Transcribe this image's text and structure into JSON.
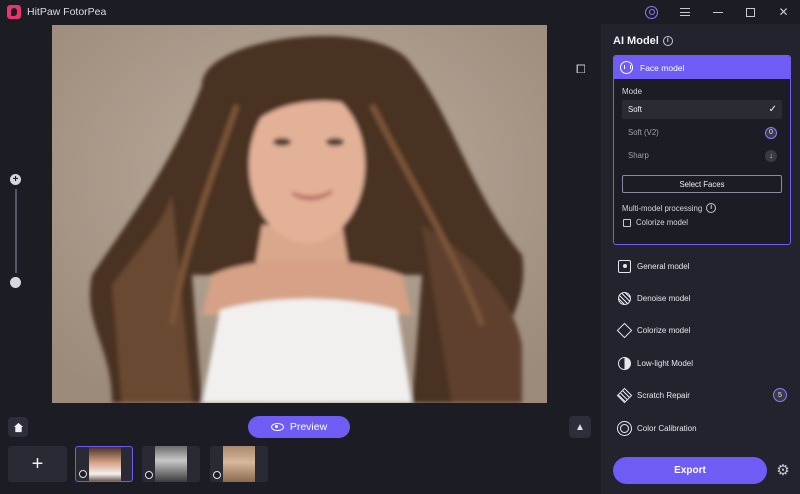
{
  "app": {
    "title": "HitPaw FotorPea"
  },
  "window_controls": {
    "user": "user-icon",
    "menu": "menu-icon",
    "minimize": "minimize-icon",
    "maximize": "maximize-icon",
    "close": "close-icon"
  },
  "canvas": {
    "zoom_in": "+",
    "zoom_out": "−"
  },
  "bottom": {
    "preview_label": "Preview",
    "add_label": "+",
    "thumbnails": [
      "portrait-color",
      "portrait-bw",
      "portrait-sepia"
    ]
  },
  "panel": {
    "title": "AI Model",
    "face_model": {
      "label": "Face model",
      "mode_label": "Mode",
      "modes": [
        {
          "label": "Soft",
          "state": "selected"
        },
        {
          "label": "Soft (V2)",
          "state": "badge",
          "badge": "0"
        },
        {
          "label": "Sharp",
          "state": "download"
        }
      ],
      "select_faces": "Select Faces",
      "multi_model": "Multi-model processing",
      "colorize_option": "Colorize model"
    },
    "models": [
      {
        "label": "General model",
        "icon": "image-icon"
      },
      {
        "label": "Denoise model",
        "icon": "denoise-icon"
      },
      {
        "label": "Colorize model",
        "icon": "colorize-icon"
      },
      {
        "label": "Low-light Model",
        "icon": "low-light-icon"
      },
      {
        "label": "Scratch Repair",
        "icon": "scratch-icon",
        "badge": "5"
      },
      {
        "label": "Color Calibration",
        "icon": "calibration-icon"
      }
    ],
    "export_label": "Export"
  },
  "colors": {
    "accent": "#6e5cf5",
    "panel_bg": "#23232d",
    "app_bg": "#1c1c24"
  }
}
